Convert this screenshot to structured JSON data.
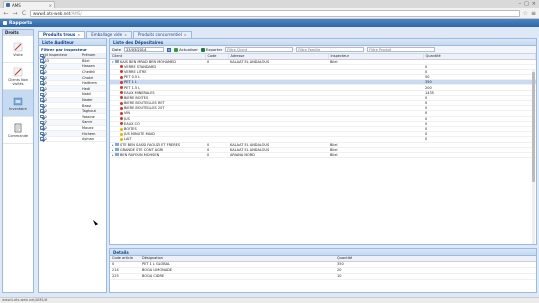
{
  "browser": {
    "tab_title": "AMS",
    "tab_close": "×",
    "url_host": "www4.ats-web.net",
    "url_path": "/AMS/",
    "win_min": "–",
    "win_max": "□",
    "win_close": "×",
    "back": "←",
    "forward": "→",
    "reload": "C",
    "star": "☆",
    "menu": "≡",
    "status": "www4.ats-web.net/AMS/#"
  },
  "app": {
    "title": "Rapports"
  },
  "rail": {
    "title": "Droits",
    "items": [
      {
        "label": "Visite",
        "icon": "pen-icon"
      },
      {
        "label": "Clients Non visités",
        "icon": "pen-icon"
      },
      {
        "label": "Inventaire",
        "icon": "box-icon"
      },
      {
        "label": "Commande",
        "icon": "document-icon"
      }
    ]
  },
  "tabs": [
    {
      "label": "Produits trous",
      "active": true
    },
    {
      "label": "Emballage vide",
      "active": false
    },
    {
      "label": "Produits concurrentiel",
      "active": false
    }
  ],
  "auditeur": {
    "title": "Liste Auditeur",
    "filter_label": "Filtrer par inspecteur",
    "col_id": "Id Inspecteur",
    "col_prenom": "Prénom",
    "rows": [
      {
        "id": "53",
        "prenom": "Bilel"
      },
      {
        "id": "0",
        "prenom": "Hassen"
      },
      {
        "id": "0",
        "prenom": "Chedhli"
      },
      {
        "id": "0",
        "prenom": "Chokri"
      },
      {
        "id": "0",
        "prenom": "Haithem"
      },
      {
        "id": "0",
        "prenom": "Hedi"
      },
      {
        "id": "0",
        "prenom": "Nabil"
      },
      {
        "id": "0",
        "prenom": "Nader"
      },
      {
        "id": "0",
        "prenom": "Bassi"
      },
      {
        "id": "0",
        "prenom": "Taghout"
      },
      {
        "id": "0",
        "prenom": "Yassine"
      },
      {
        "id": "0",
        "prenom": "Samir"
      },
      {
        "id": "0",
        "prenom": "Mouez"
      },
      {
        "id": "0",
        "prenom": "Hichem"
      },
      {
        "id": "0",
        "prenom": "Ayman"
      }
    ]
  },
  "main": {
    "title": "Liste des Dépositaires",
    "date_label": "Date",
    "date_value": "23/03/2014",
    "refresh_label": "Actualiser",
    "export_label": "Exporter",
    "filter_client": "Filtre Client",
    "filter_famille": "Filtre Famille",
    "filter_produit": "Filtre Produit",
    "columns": [
      "Client",
      "Code",
      "Adresse",
      "Inspecteur",
      "Quantité"
    ],
    "rows": [
      {
        "client": "KAIS BEN MRAD BEN MOHAMED",
        "code": "0",
        "adresse": "KALAAT EL ANDALOUS",
        "inspecteur": "Bilel",
        "qte": "",
        "level": 0,
        "icon": "folder",
        "expanded": true
      },
      {
        "client": "VERRE STANDARD",
        "code": "",
        "adresse": "",
        "inspecteur": "",
        "qte": "0",
        "level": 1,
        "icon": "red"
      },
      {
        "client": "VERRE LITRE",
        "code": "",
        "adresse": "",
        "inspecteur": "",
        "qte": "0",
        "level": 1,
        "icon": "red"
      },
      {
        "client": "PET 0.5 L",
        "code": "",
        "adresse": "",
        "inspecteur": "",
        "qte": "50",
        "level": 1,
        "icon": "red"
      },
      {
        "client": "PET 1 L",
        "code": "",
        "adresse": "",
        "inspecteur": "",
        "qte": "350",
        "level": 1,
        "icon": "red",
        "selected": true
      },
      {
        "client": "PET 1.5 L",
        "code": "",
        "adresse": "",
        "inspecteur": "",
        "qte": "200",
        "level": 1,
        "icon": "red"
      },
      {
        "client": "EAUX MINERALES",
        "code": "",
        "adresse": "",
        "inspecteur": "",
        "qte": "1435",
        "level": 1,
        "icon": "red"
      },
      {
        "client": "BIERE BOITES",
        "code": "",
        "adresse": "",
        "inspecteur": "",
        "qte": "0",
        "level": 1,
        "icon": "red"
      },
      {
        "client": "BIERE BOUTEILLES RET",
        "code": "",
        "adresse": "",
        "inspecteur": "",
        "qte": "0",
        "level": 1,
        "icon": "red"
      },
      {
        "client": "BIERE BOUTEILLES 20T",
        "code": "",
        "adresse": "",
        "inspecteur": "",
        "qte": "0",
        "level": 1,
        "icon": "red"
      },
      {
        "client": "VIN",
        "code": "",
        "adresse": "",
        "inspecteur": "",
        "qte": "0",
        "level": 1,
        "icon": "red"
      },
      {
        "client": "JUS",
        "code": "",
        "adresse": "",
        "inspecteur": "",
        "qte": "0",
        "level": 1,
        "icon": "red"
      },
      {
        "client": "EAUX CO",
        "code": "",
        "adresse": "",
        "inspecteur": "",
        "qte": "0",
        "level": 1,
        "icon": "red"
      },
      {
        "client": "BOITES",
        "code": "",
        "adresse": "",
        "inspecteur": "",
        "qte": "0",
        "level": 1,
        "icon": "yellow"
      },
      {
        "client": "JUS MINUTE MAID",
        "code": "",
        "adresse": "",
        "inspecteur": "",
        "qte": "0",
        "level": 1,
        "icon": "yellow"
      },
      {
        "client": "LAIT",
        "code": "",
        "adresse": "",
        "inspecteur": "",
        "qte": "0",
        "level": 1,
        "icon": "yellow"
      },
      {
        "client": "STE BEN SASSI FAOUZI ET FRERES",
        "code": "0",
        "adresse": "KALAAT EL ANDALOUS",
        "inspecteur": "Bilel",
        "qte": "",
        "level": 0,
        "icon": "folder"
      },
      {
        "client": "GRANDE STE CONT AGRI",
        "code": "0",
        "adresse": "KALAAT EL ANDALOUS",
        "inspecteur": "Bilel",
        "qte": "",
        "level": 0,
        "icon": "folder"
      },
      {
        "client": "BEN RAYOUN MOHSEN",
        "code": "0",
        "adresse": "ARIANA NORD",
        "inspecteur": "Bilel",
        "qte": "",
        "level": 0,
        "icon": "folder"
      }
    ]
  },
  "details": {
    "title": "Details",
    "columns": [
      "Code article",
      "Désignation",
      "Quantité"
    ],
    "rows": [
      {
        "code": "0",
        "designation": "PET 1 L GLOBAL",
        "qte": "350"
      },
      {
        "code": "214",
        "designation": "BOGA LIMONADE",
        "qte": "20"
      },
      {
        "code": "225",
        "designation": "BOGA CIDRE",
        "qte": "10"
      }
    ]
  },
  "colors": {
    "header_blue": "#2f67a6",
    "panel_border": "#99bbe8",
    "selection": "#c8dbf3",
    "red_icon": "#d9342b",
    "yellow_icon": "#e8b400"
  }
}
